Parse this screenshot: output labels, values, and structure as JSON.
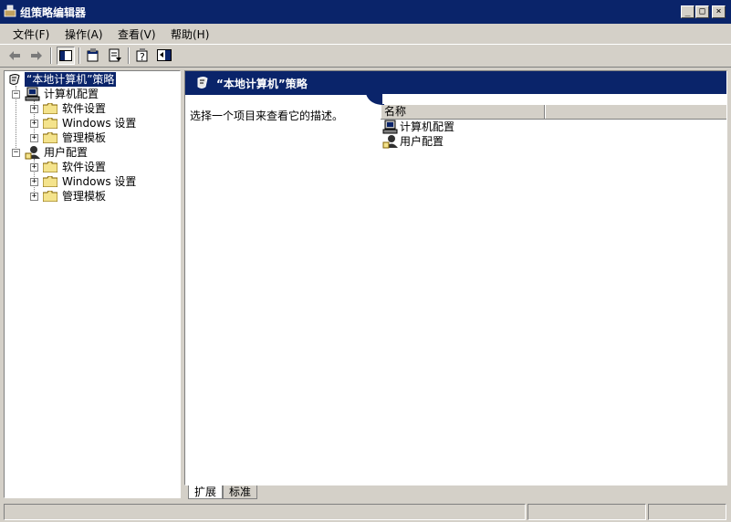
{
  "window": {
    "title": "组策略编辑器",
    "minimize": "_",
    "maximize": "□",
    "close": "×"
  },
  "menu": [
    {
      "label": "文件(F)"
    },
    {
      "label": "操作(A)"
    },
    {
      "label": "查看(V)"
    },
    {
      "label": "帮助(H)"
    }
  ],
  "toolbar": {
    "back_icon": "arrow-left",
    "forward_icon": "arrow-right",
    "tools": [
      "show-hide-tree",
      "properties",
      "export-list",
      "help",
      "action-pane"
    ]
  },
  "tree": {
    "root": "“本地计算机”策略",
    "computer": {
      "label": "计算机配置",
      "children": [
        "软件设置",
        "Windows 设置",
        "管理模板"
      ]
    },
    "user": {
      "label": "用户配置",
      "children": [
        "软件设置",
        "Windows 设置",
        "管理模板"
      ]
    }
  },
  "details": {
    "banner_title": "“本地计算机”策略",
    "description": "选择一个项目来查看它的描述。",
    "column_name": "名称",
    "items": [
      "计算机配置",
      "用户配置"
    ]
  },
  "tabs": {
    "extended": "扩展",
    "standard": "标准"
  },
  "colors": {
    "titlebar": "#0a246a",
    "face": "#d4d0c8",
    "selection": "#0a246a"
  }
}
